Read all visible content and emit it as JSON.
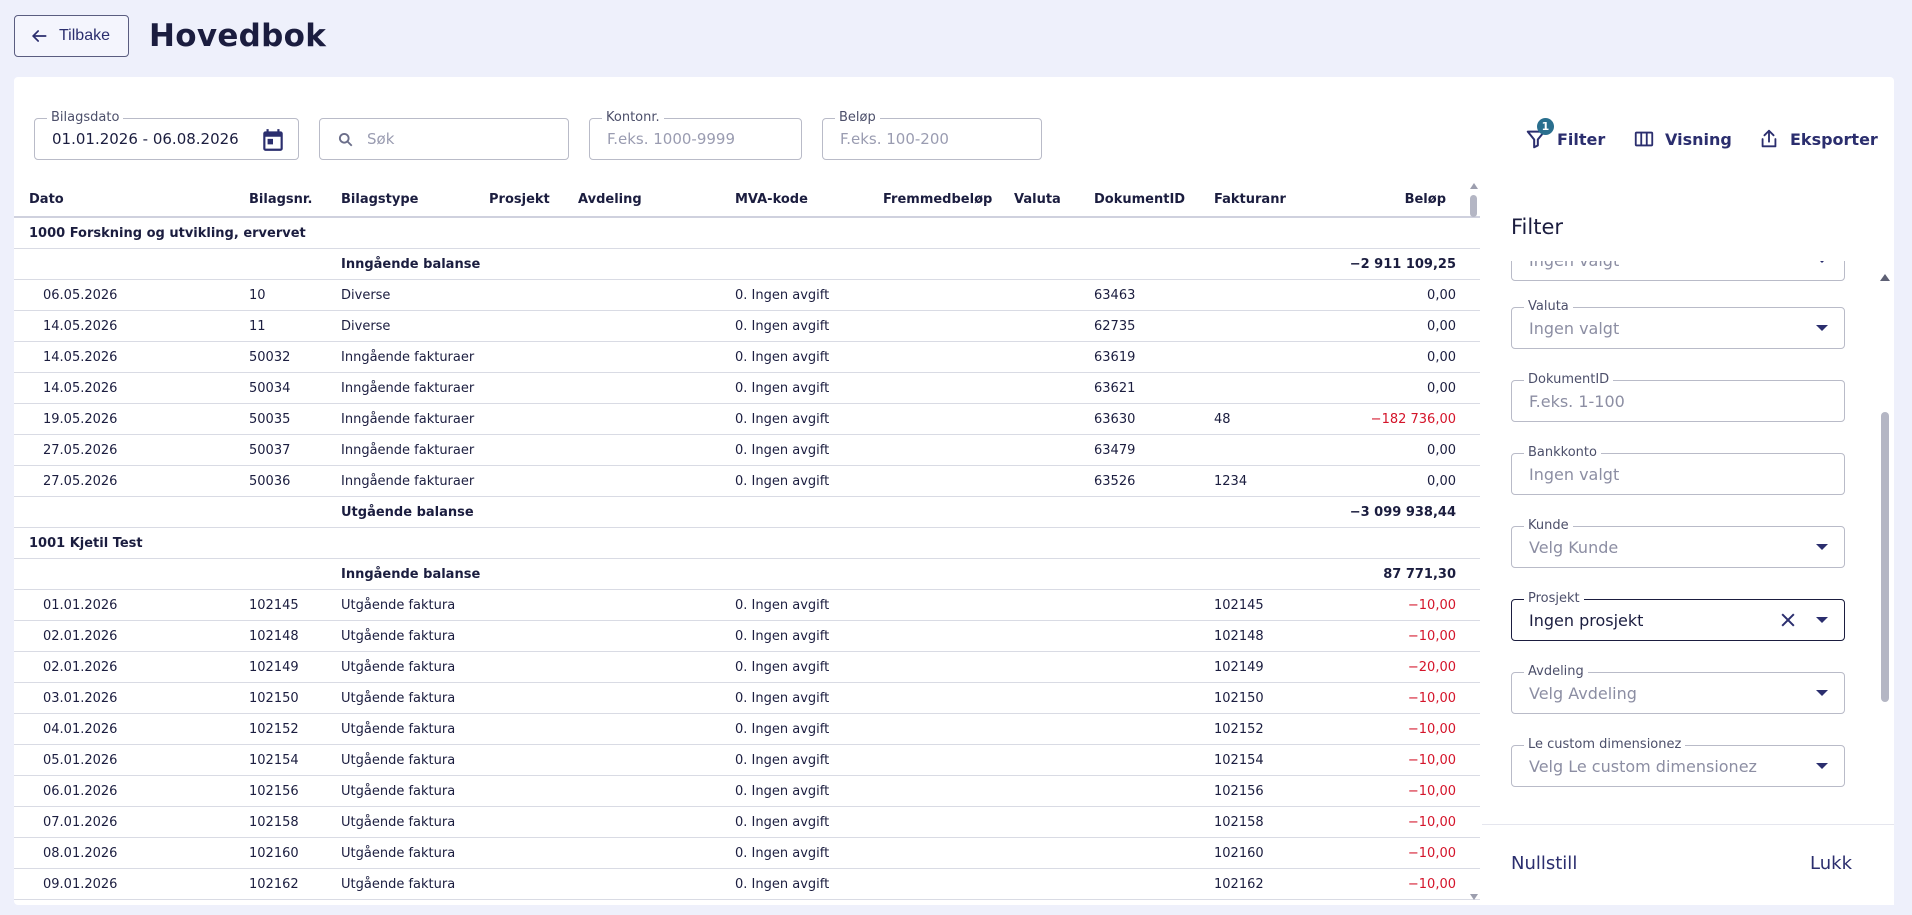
{
  "header": {
    "back_label": "Tilbake",
    "title": "Hovedbok"
  },
  "filters": {
    "date": {
      "label": "Bilagsdato",
      "value": "01.01.2026 - 06.08.2026"
    },
    "search": {
      "placeholder": "Søk"
    },
    "account": {
      "label": "Kontonr.",
      "placeholder": "F.eks. 1000-9999"
    },
    "amount": {
      "label": "Beløp",
      "placeholder": "F.eks. 100-200"
    }
  },
  "toolbar": {
    "filter_label": "Filter",
    "filter_count": "1",
    "view_label": "Visning",
    "export_label": "Eksporter"
  },
  "table": {
    "columns": [
      "Dato",
      "Bilagsnr.",
      "Bilagstype",
      "Prosjekt",
      "Avdeling",
      "MVA-kode",
      "Fremmedbeløp",
      "Valuta",
      "DokumentID",
      "Fakturanr",
      "Beløp"
    ],
    "rows": [
      {
        "kind": "group",
        "title": "1000 Forskning og utvikling, ervervet"
      },
      {
        "kind": "balance",
        "label": "Inngående balanse",
        "amount": "−2 911 109,25"
      },
      {
        "kind": "data",
        "date": "06.05.2026",
        "no": "10",
        "type": "Diverse",
        "vat": "0. Ingen avgift",
        "doc": "63463",
        "inv": "",
        "amount": "0,00"
      },
      {
        "kind": "data",
        "date": "14.05.2026",
        "no": "11",
        "type": "Diverse",
        "vat": "0. Ingen avgift",
        "doc": "62735",
        "inv": "",
        "amount": "0,00"
      },
      {
        "kind": "data",
        "date": "14.05.2026",
        "no": "50032",
        "type": "Inngående fakturaer",
        "vat": "0. Ingen avgift",
        "doc": "63619",
        "inv": "",
        "amount": "0,00"
      },
      {
        "kind": "data",
        "date": "14.05.2026",
        "no": "50034",
        "type": "Inngående fakturaer",
        "vat": "0. Ingen avgift",
        "doc": "63621",
        "inv": "",
        "amount": "0,00"
      },
      {
        "kind": "data",
        "date": "19.05.2026",
        "no": "50035",
        "type": "Inngående fakturaer",
        "vat": "0. Ingen avgift",
        "doc": "63630",
        "inv": "48",
        "amount": "−182 736,00",
        "neg": true
      },
      {
        "kind": "data",
        "date": "27.05.2026",
        "no": "50037",
        "type": "Inngående fakturaer",
        "vat": "0. Ingen avgift",
        "doc": "63479",
        "inv": "",
        "amount": "0,00"
      },
      {
        "kind": "data",
        "date": "27.05.2026",
        "no": "50036",
        "type": "Inngående fakturaer",
        "vat": "0. Ingen avgift",
        "doc": "63526",
        "inv": "1234",
        "amount": "0,00"
      },
      {
        "kind": "balance",
        "label": "Utgående balanse",
        "amount": "−3 099 938,44"
      },
      {
        "kind": "group",
        "title": "1001 Kjetil Test"
      },
      {
        "kind": "balance",
        "label": "Inngående balanse",
        "amount": "87 771,30"
      },
      {
        "kind": "data",
        "date": "01.01.2026",
        "no": "102145",
        "type": "Utgående faktura",
        "vat": "0. Ingen avgift",
        "doc": "",
        "inv": "102145",
        "amount": "−10,00",
        "neg": true
      },
      {
        "kind": "data",
        "date": "02.01.2026",
        "no": "102148",
        "type": "Utgående faktura",
        "vat": "0. Ingen avgift",
        "doc": "",
        "inv": "102148",
        "amount": "−10,00",
        "neg": true
      },
      {
        "kind": "data",
        "date": "02.01.2026",
        "no": "102149",
        "type": "Utgående faktura",
        "vat": "0. Ingen avgift",
        "doc": "",
        "inv": "102149",
        "amount": "−20,00",
        "neg": true
      },
      {
        "kind": "data",
        "date": "03.01.2026",
        "no": "102150",
        "type": "Utgående faktura",
        "vat": "0. Ingen avgift",
        "doc": "",
        "inv": "102150",
        "amount": "−10,00",
        "neg": true
      },
      {
        "kind": "data",
        "date": "04.01.2026",
        "no": "102152",
        "type": "Utgående faktura",
        "vat": "0. Ingen avgift",
        "doc": "",
        "inv": "102152",
        "amount": "−10,00",
        "neg": true
      },
      {
        "kind": "data",
        "date": "05.01.2026",
        "no": "102154",
        "type": "Utgående faktura",
        "vat": "0. Ingen avgift",
        "doc": "",
        "inv": "102154",
        "amount": "−10,00",
        "neg": true
      },
      {
        "kind": "data",
        "date": "06.01.2026",
        "no": "102156",
        "type": "Utgående faktura",
        "vat": "0. Ingen avgift",
        "doc": "",
        "inv": "102156",
        "amount": "−10,00",
        "neg": true
      },
      {
        "kind": "data",
        "date": "07.01.2026",
        "no": "102158",
        "type": "Utgående faktura",
        "vat": "0. Ingen avgift",
        "doc": "",
        "inv": "102158",
        "amount": "−10,00",
        "neg": true
      },
      {
        "kind": "data",
        "date": "08.01.2026",
        "no": "102160",
        "type": "Utgående faktura",
        "vat": "0. Ingen avgift",
        "doc": "",
        "inv": "102160",
        "amount": "−10,00",
        "neg": true
      },
      {
        "kind": "data",
        "date": "09.01.2026",
        "no": "102162",
        "type": "Utgående faktura",
        "vat": "0. Ingen avgift",
        "doc": "",
        "inv": "102162",
        "amount": "−10,00",
        "neg": true
      }
    ]
  },
  "panel": {
    "title": "Filter",
    "partial_value": "Ingen valgt",
    "fields": [
      {
        "name": "valuta",
        "label": "Valuta",
        "placeholder": "Ingen valgt",
        "dropdown": true
      },
      {
        "name": "dokumentid",
        "label": "DokumentID",
        "placeholder": "F.eks. 1-100",
        "dropdown": false
      },
      {
        "name": "bankkonto",
        "label": "Bankkonto",
        "placeholder": "Ingen valgt",
        "dropdown": false
      },
      {
        "name": "kunde",
        "label": "Kunde",
        "placeholder": "Velg Kunde",
        "dropdown": true
      },
      {
        "name": "prosjekt",
        "label": "Prosjekt",
        "value": "Ingen prosjekt",
        "dropdown": true,
        "active": true
      },
      {
        "name": "avdeling",
        "label": "Avdeling",
        "placeholder": "Velg Avdeling",
        "dropdown": true
      },
      {
        "name": "le-custom",
        "label": "Le custom dimensionez",
        "placeholder": "Velg Le custom dimensionez",
        "dropdown": true
      }
    ],
    "reset_label": "Nullstill",
    "close_label": "Lukk"
  },
  "colors": {
    "accent": "#2b2e6e",
    "negative": "#d4142a",
    "badge": "#2a6f8e",
    "background": "#eef0fb"
  }
}
